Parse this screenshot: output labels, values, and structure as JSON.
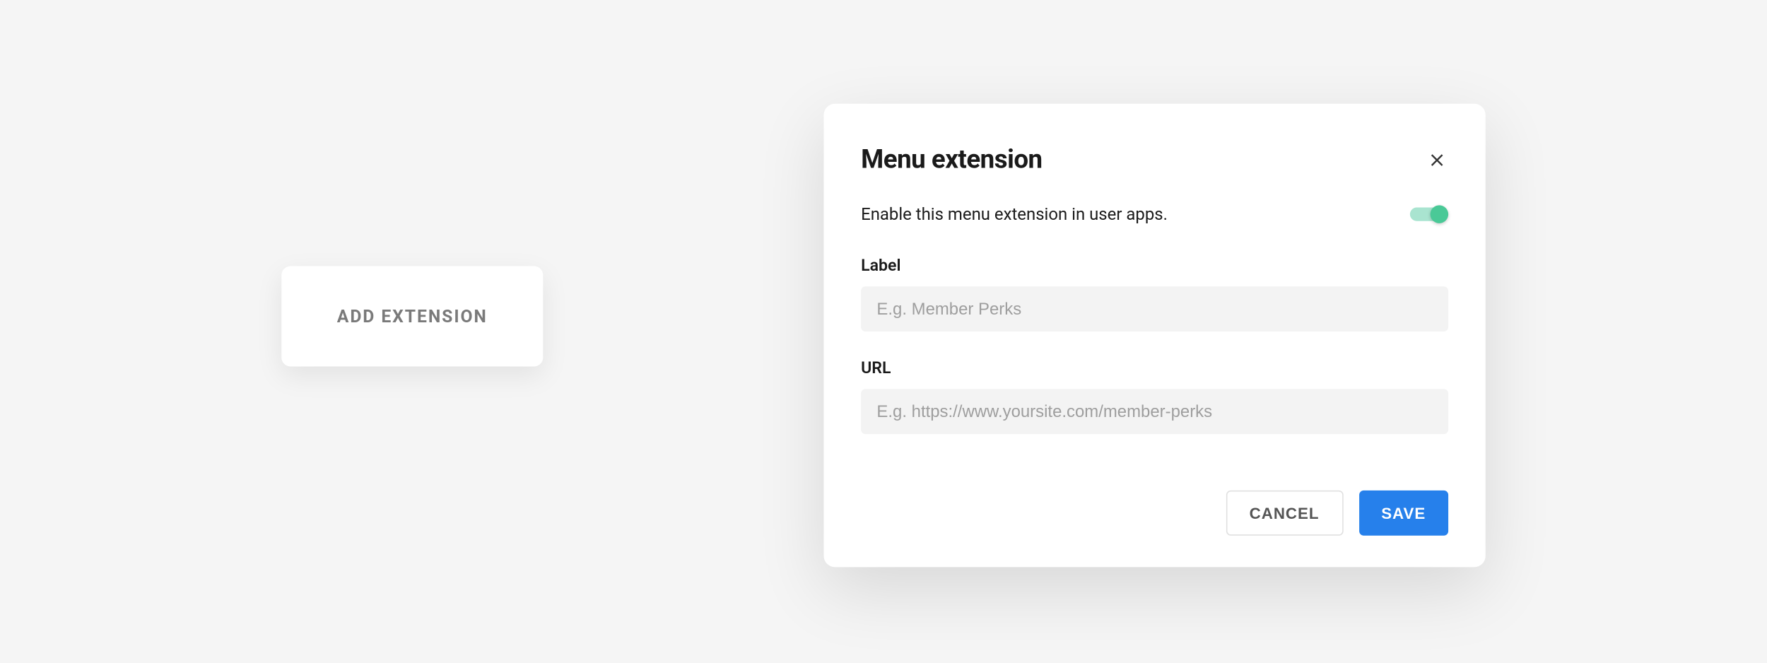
{
  "add_extension_button": {
    "label": "ADD EXTENSION"
  },
  "modal": {
    "title": "Menu extension",
    "enable_text": "Enable this menu extension in user apps.",
    "toggle_on": true,
    "fields": {
      "label": {
        "label": "Label",
        "placeholder": "E.g. Member Perks",
        "value": ""
      },
      "url": {
        "label": "URL",
        "placeholder": "E.g. https://www.yoursite.com/member-perks",
        "value": ""
      }
    },
    "actions": {
      "cancel_label": "CANCEL",
      "save_label": "SAVE"
    }
  }
}
